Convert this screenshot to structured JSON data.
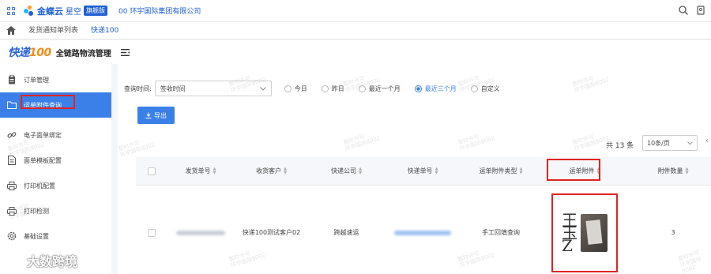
{
  "topbar": {
    "logo_text": "金蝶云",
    "logo_sub": "星空",
    "edition_badge": "旗舰版",
    "company": "00 环宇国际集团有限公司",
    "icons": [
      "apps-icon",
      "search-icon",
      "user-icon"
    ]
  },
  "tabs": [
    {
      "label": "发货通知单列表",
      "active": false
    },
    {
      "label": "快递100",
      "active": true
    }
  ],
  "header": {
    "logo_main": "快递",
    "logo_num": "100",
    "title": "全链路物流管理"
  },
  "sidebar": {
    "items": [
      {
        "label": "订单管理",
        "icon": "clipboard-icon",
        "active": false
      },
      {
        "label": "运单附件查询",
        "icon": "folder-icon",
        "active": true
      },
      {
        "label": "电子面单绑定",
        "icon": "link-icon",
        "active": false
      },
      {
        "label": "面单模板配置",
        "icon": "document-icon",
        "active": false
      },
      {
        "label": "打印机配置",
        "icon": "printer-icon",
        "active": false
      },
      {
        "label": "打印检测",
        "icon": "printer-check-icon",
        "active": false
      },
      {
        "label": "基础设置",
        "icon": "settings-icon",
        "active": false
      }
    ]
  },
  "filter": {
    "label": "查询时间:",
    "select_value": "签收时间",
    "radios": [
      {
        "label": "今日",
        "checked": false
      },
      {
        "label": "昨日",
        "checked": false
      },
      {
        "label": "最近一个月",
        "checked": false
      },
      {
        "label": "最近三个月",
        "checked": true
      },
      {
        "label": "自定义",
        "checked": false
      }
    ]
  },
  "toolbar": {
    "export_label": "导出"
  },
  "pagination": {
    "total": "共 13 条",
    "page_size": "10条/页"
  },
  "table": {
    "columns": [
      "发货单号",
      "收货客户",
      "快递公司",
      "快递单号",
      "运单附件类型",
      "运单附件",
      "附件数量"
    ],
    "rows": [
      {
        "customer": "快递100测试客户02",
        "courier": "跨越速运",
        "attachment_type": "手工回填查询",
        "count": "3"
      }
    ]
  },
  "watermark": {
    "line1": "暂时许可",
    "line2": "环宇国际8002",
    "brand": "大数跨境"
  }
}
